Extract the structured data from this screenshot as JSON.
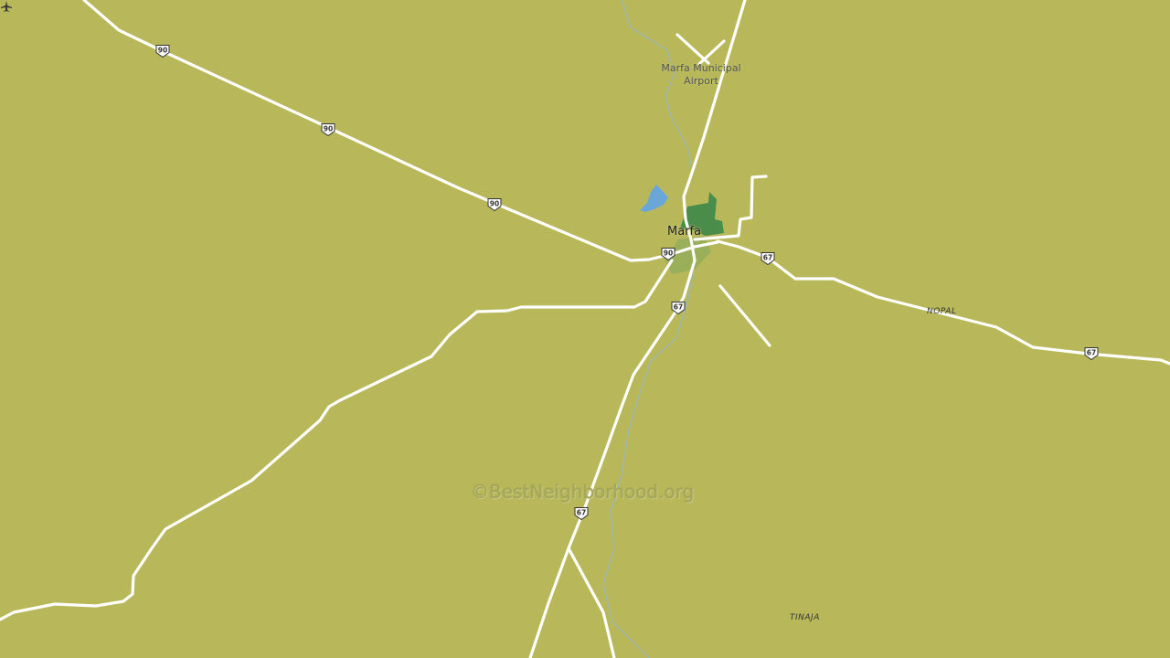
{
  "map": {
    "town": "Marfa",
    "airport": "Marfa Municipal Airport",
    "places": [
      "NOPAL",
      "TINAJA"
    ],
    "route_shields": [
      {
        "id": "us90-a",
        "route": "90"
      },
      {
        "id": "us90-b",
        "route": "90"
      },
      {
        "id": "us90-c",
        "route": "90"
      },
      {
        "id": "us90-d",
        "route": "90"
      },
      {
        "id": "us67-a",
        "route": "67"
      },
      {
        "id": "us67-b",
        "route": "67"
      },
      {
        "id": "us67-c",
        "route": "67"
      },
      {
        "id": "us67-d",
        "route": "67"
      }
    ],
    "watermark": "©BestNeighborhood.org",
    "colors": {
      "land": "#b8b85b",
      "road": "#ffffff",
      "town_park": "#4a8c4a",
      "urban": "#9aaf5a",
      "water": "#6aa6d8",
      "creek": "#9fb7a8"
    }
  }
}
